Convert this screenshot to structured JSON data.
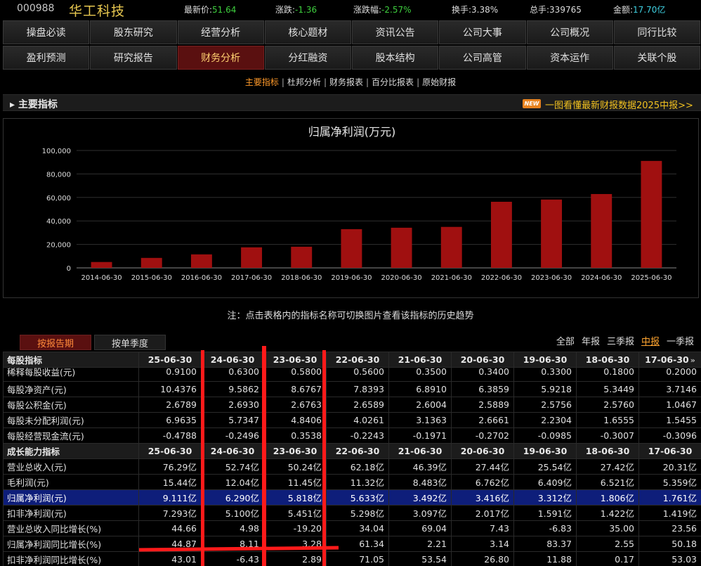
{
  "quote": {
    "code": "000988",
    "name": "华工科技",
    "price_label": "最新价:",
    "price": "51.64",
    "change_label": "涨跌:",
    "change": "-1.36",
    "pct_label": "涨跌幅:",
    "pct": "-2.57%",
    "turnover_label": "换手:",
    "turnover": "3.38%",
    "volume_label": "总手:",
    "volume": "339765",
    "amount_label": "金额:",
    "amount": "17.70亿"
  },
  "nav": {
    "row1": [
      "操盘必读",
      "股东研究",
      "经营分析",
      "核心题材",
      "资讯公告",
      "公司大事",
      "公司概况",
      "同行比较"
    ],
    "row2": [
      "盈利预测",
      "研究报告",
      "财务分析",
      "分红融资",
      "股本结构",
      "公司高管",
      "资本运作",
      "关联个股"
    ],
    "active": "财务分析"
  },
  "subtabs": [
    "主要指标",
    "杜邦分析",
    "财务报表",
    "百分比报表",
    "原始财报"
  ],
  "section": {
    "title": "主要指标",
    "badge": "NEW",
    "promo": "一图看懂最新财报数据2025中报>>"
  },
  "chart_data": {
    "type": "bar",
    "title": "归属净利润(万元)",
    "categories": [
      "2014-06-30",
      "2015-06-30",
      "2016-06-30",
      "2017-06-30",
      "2018-06-30",
      "2019-06-30",
      "2020-06-30",
      "2021-06-30",
      "2022-06-30",
      "2023-06-30",
      "2024-06-30",
      "2025-06-30"
    ],
    "values": [
      5000,
      8500,
      11500,
      17500,
      18000,
      33000,
      34200,
      34900,
      56300,
      58200,
      62900,
      91100
    ],
    "ylim": [
      0,
      100000
    ],
    "yticks": [
      "0",
      "20,000",
      "40,000",
      "60,000",
      "80,000",
      "100,000"
    ],
    "grid": true,
    "bar_color": "#a01010"
  },
  "note": "注：点击表格内的指标名称可切换图片查看该指标的历史趋势",
  "mode_tabs": [
    "按报告期",
    "按单季度"
  ],
  "period_tabs": [
    "全部",
    "年报",
    "三季报",
    "中报",
    "一季报"
  ],
  "table": {
    "per_share_header": "每股指标",
    "growth_header": "成长能力指标",
    "columns": [
      "25-06-30",
      "24-06-30",
      "23-06-30",
      "22-06-30",
      "21-06-30",
      "20-06-30",
      "19-06-30",
      "18-06-30",
      "17-06-30"
    ],
    "more_icon": "»",
    "per_share_rows": [
      {
        "label": "稀释每股收益(元)",
        "values": [
          "0.9100",
          "0.6300",
          "0.5800",
          "0.5600",
          "0.3500",
          "0.3400",
          "0.3300",
          "0.1800",
          "0.2000"
        ]
      },
      {
        "label": "每股净资产(元)",
        "values": [
          "10.4376",
          "9.5862",
          "8.6767",
          "7.8393",
          "6.8910",
          "6.3859",
          "5.9218",
          "5.3449",
          "3.7146"
        ]
      },
      {
        "label": "每股公积金(元)",
        "values": [
          "2.6789",
          "2.6930",
          "2.6763",
          "2.6589",
          "2.6004",
          "2.5889",
          "2.5756",
          "2.5760",
          "1.0467"
        ]
      },
      {
        "label": "每股未分配利润(元)",
        "values": [
          "6.9635",
          "5.7347",
          "4.8406",
          "4.0261",
          "3.1363",
          "2.6661",
          "2.2304",
          "1.6555",
          "1.5455"
        ]
      },
      {
        "label": "每股经营现金流(元)",
        "values": [
          "-0.4788",
          "-0.2496",
          "0.3538",
          "-0.2243",
          "-0.1971",
          "-0.2702",
          "-0.0985",
          "-0.3007",
          "-0.3096"
        ]
      }
    ],
    "growth_rows": [
      {
        "label": "营业总收入(元)",
        "values": [
          "76.29亿",
          "52.74亿",
          "50.24亿",
          "62.18亿",
          "46.39亿",
          "27.44亿",
          "25.54亿",
          "27.42亿",
          "20.31亿"
        ]
      },
      {
        "label": "毛利润(元)",
        "values": [
          "15.44亿",
          "12.04亿",
          "11.45亿",
          "11.32亿",
          "8.483亿",
          "6.762亿",
          "6.409亿",
          "6.521亿",
          "5.359亿"
        ]
      },
      {
        "label": "归属净利润(元)",
        "values": [
          "9.111亿",
          "6.290亿",
          "5.818亿",
          "5.633亿",
          "3.492亿",
          "3.416亿",
          "3.312亿",
          "1.806亿",
          "1.761亿"
        ],
        "highlight": true
      },
      {
        "label": "扣非净利润(元)",
        "values": [
          "7.293亿",
          "5.100亿",
          "5.451亿",
          "5.298亿",
          "3.097亿",
          "2.017亿",
          "1.591亿",
          "1.422亿",
          "1.419亿"
        ]
      },
      {
        "label": "营业总收入同比增长(%)",
        "values": [
          "44.66",
          "4.98",
          "-19.20",
          "34.04",
          "69.04",
          "7.43",
          "-6.83",
          "35.00",
          "23.56"
        ]
      },
      {
        "label": "归属净利润同比增长(%)",
        "values": [
          "44.87",
          "8.11",
          "3.28",
          "61.34",
          "2.21",
          "3.14",
          "83.37",
          "2.55",
          "50.18"
        ]
      },
      {
        "label": "扣非净利润同比增长(%)",
        "values": [
          "43.01",
          "-6.43",
          "2.89",
          "71.05",
          "53.54",
          "26.80",
          "11.88",
          "0.17",
          "53.03"
        ]
      }
    ]
  }
}
